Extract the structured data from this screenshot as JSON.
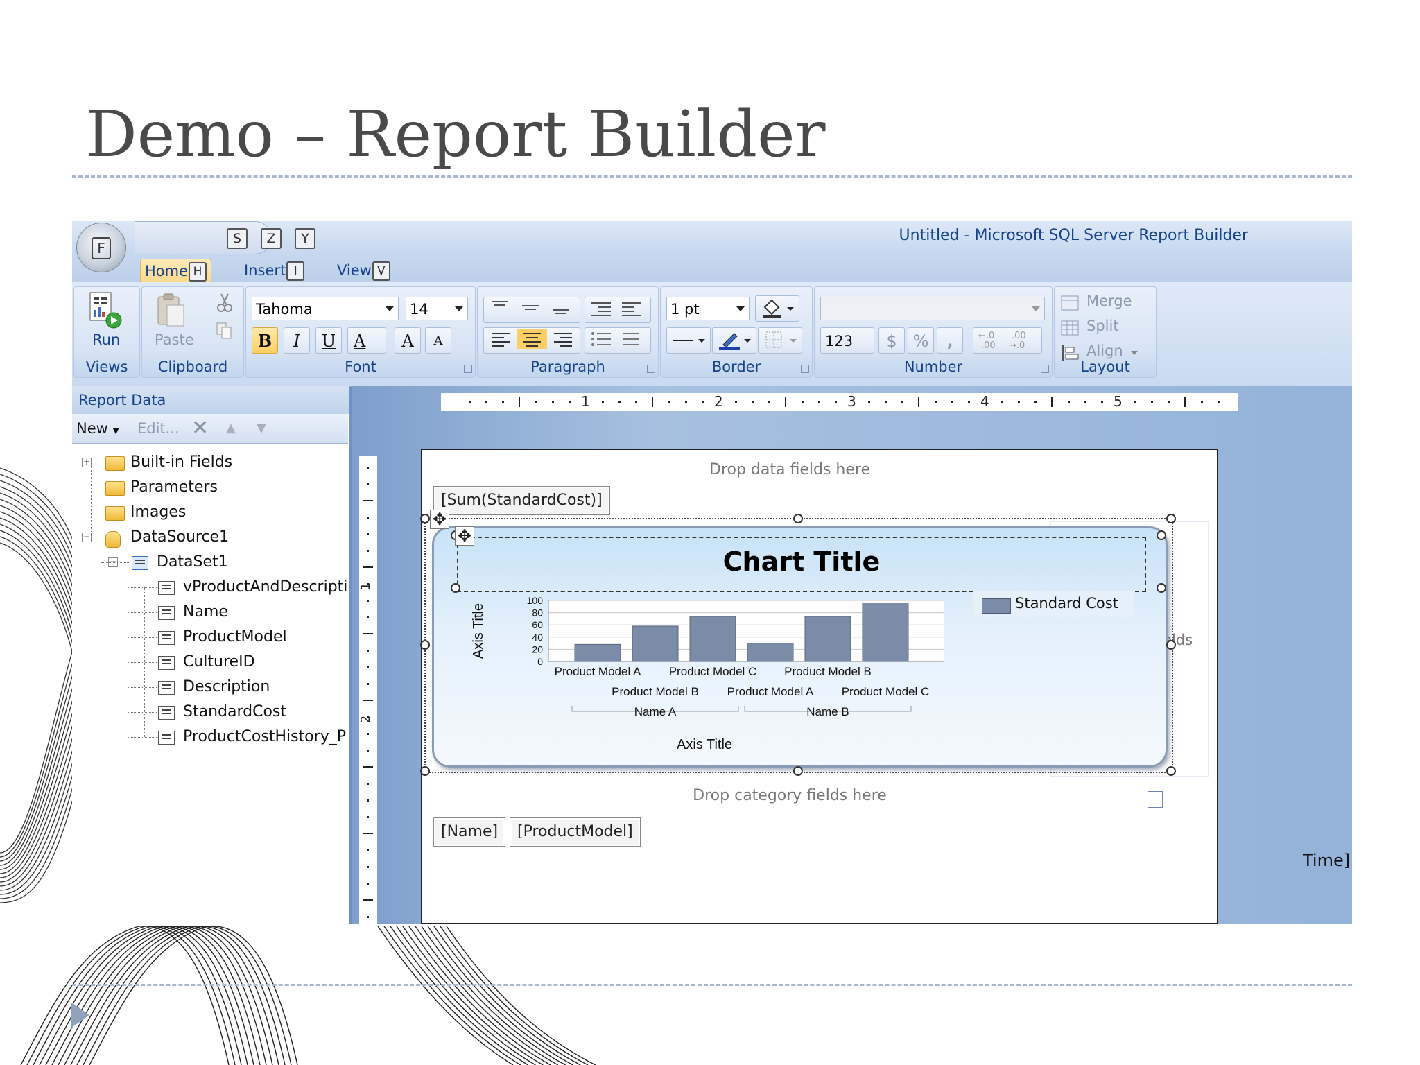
{
  "slide": {
    "title": "Demo – Report Builder"
  },
  "window": {
    "title": "Untitled - Microsoft SQL Server Report Builder"
  },
  "office_button": {
    "key": "F"
  },
  "qat_keys": [
    "S",
    "Z",
    "Y"
  ],
  "tabs": [
    {
      "label": "Home",
      "key": "H",
      "active": true
    },
    {
      "label": "Insert",
      "key": "I",
      "active": false
    },
    {
      "label": "View",
      "key": "V",
      "active": false
    }
  ],
  "ribbon": {
    "views": {
      "run_label": "Run",
      "group_label": "Views"
    },
    "clipboard": {
      "paste_label": "Paste",
      "group_label": "Clipboard"
    },
    "font": {
      "family": "Tahoma",
      "size": "14",
      "bold": "B",
      "italic": "I",
      "underline": "U",
      "color": "A",
      "grow": "A",
      "shrink": "A",
      "group_label": "Font"
    },
    "paragraph": {
      "group_label": "Paragraph"
    },
    "border": {
      "width": "1 pt",
      "group_label": "Border"
    },
    "number": {
      "format": "123",
      "currency": "$",
      "percent": "%",
      "comma": ",",
      "group_label": "Number"
    },
    "layout": {
      "merge": "Merge",
      "split": "Split",
      "align": "Align",
      "group_label": "Layout"
    }
  },
  "report_data": {
    "header": "Report Data",
    "new_label": "New",
    "edit_label": "Edit...",
    "tree": [
      {
        "label": "Built-in Fields",
        "type": "folder",
        "level": 0,
        "expander": "+"
      },
      {
        "label": "Parameters",
        "type": "folder",
        "level": 0
      },
      {
        "label": "Images",
        "type": "folder",
        "level": 0
      },
      {
        "label": "DataSource1",
        "type": "datasource",
        "level": 0,
        "expander": "-"
      },
      {
        "label": "DataSet1",
        "type": "dataset",
        "level": 1,
        "expander": "-"
      },
      {
        "label": "vProductAndDescripti",
        "type": "field",
        "level": 2
      },
      {
        "label": "Name",
        "type": "field",
        "level": 2
      },
      {
        "label": "ProductModel",
        "type": "field",
        "level": 2
      },
      {
        "label": "CultureID",
        "type": "field",
        "level": 2
      },
      {
        "label": "Description",
        "type": "field",
        "level": 2
      },
      {
        "label": "StandardCost",
        "type": "field",
        "level": 2
      },
      {
        "label": "ProductCostHistory_P",
        "type": "field",
        "level": 2
      }
    ]
  },
  "ruler": {
    "h_marks": [
      "1",
      "2",
      "3",
      "4",
      "5"
    ],
    "v_marks": [
      "1",
      "2"
    ]
  },
  "design": {
    "drop_data": "Drop data fields here",
    "data_field": "[Sum(StandardCost)]",
    "drop_series": "Drop series fields here",
    "drop_category": "Drop category fields here",
    "category_fields": [
      "[Name]",
      "[ProductModel]"
    ],
    "footer_text": "Time]"
  },
  "chart_data": {
    "type": "bar",
    "title": "Chart Title",
    "categories": [
      "Product Model A",
      "Product Model B",
      "Product Model C",
      "Product Model A",
      "Product Model B",
      "Product Model C"
    ],
    "groups": [
      {
        "label": "Name A",
        "categories": [
          "Product Model A",
          "Product Model B",
          "Product Model C"
        ]
      },
      {
        "label": "Name B",
        "categories": [
          "Product Model A",
          "Product Model B",
          "Product Model C"
        ]
      }
    ],
    "series": [
      {
        "name": "Standard Cost",
        "values": [
          28,
          58,
          74,
          30,
          74,
          96
        ],
        "color": "#7b8ca8"
      }
    ],
    "yticks": [
      0,
      20,
      40,
      60,
      80,
      100
    ],
    "ylim": [
      0,
      100
    ],
    "xlabel": "Axis Title",
    "ylabel": "Axis Title",
    "grid": true,
    "legend": "top-right"
  }
}
